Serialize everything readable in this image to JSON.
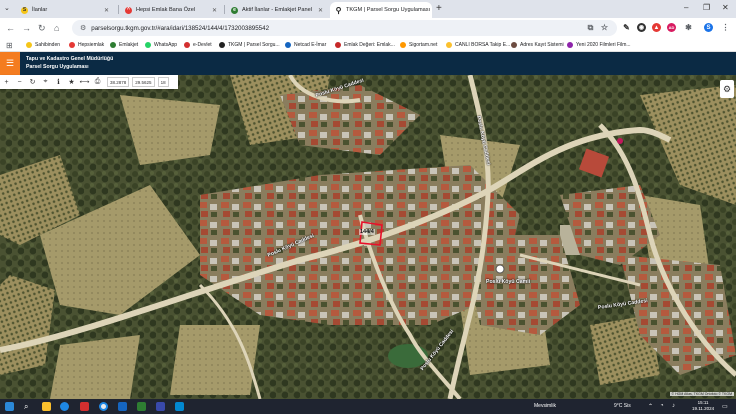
{
  "browser": {
    "tabs": [
      {
        "title": "İlanlar",
        "active": false,
        "color": "#f5c518",
        "letter": "S"
      },
      {
        "title": "Hepsi Emlak Bana Özel",
        "active": false,
        "color": "#e53935",
        "letter": "^"
      },
      {
        "title": "Aktif İlanlar - Emlakjet Panel",
        "active": false,
        "color": "#2e7d32",
        "letter": "e"
      },
      {
        "title": "TKGM | Parsel Sorgu Uygulaması",
        "active": true,
        "color": "#222222",
        "letter": "•"
      }
    ],
    "url": "parselsorgu.tkgm.gov.tr/#ara/idari/138524/144/4/1732003895542"
  },
  "bookmarks": [
    {
      "label": "Sahibinden",
      "color": "#f5c518"
    },
    {
      "label": "Hepsiemlak",
      "color": "#e53935"
    },
    {
      "label": "Emlakjet",
      "color": "#2e7d32"
    },
    {
      "label": "WhatsApp",
      "color": "#25d366"
    },
    {
      "label": "e-Devlet",
      "color": "#d32f2f"
    },
    {
      "label": "TKGM | Parsel Sorgu...",
      "color": "#222222"
    },
    {
      "label": "Netcad E-İmar",
      "color": "#1565c0"
    },
    {
      "label": "Emlak Değeri: Emlak...",
      "color": "#c62828"
    },
    {
      "label": "Sigortam.net",
      "color": "#ff9800"
    },
    {
      "label": "CANLI BORSA Takip E...",
      "color": "#fbc02d"
    },
    {
      "label": "Adres Kayıt Sistemi",
      "color": "#6d4c41"
    },
    {
      "label": "Yeni 2020 Filmleri Film...",
      "color": "#8e24aa"
    }
  ],
  "app": {
    "title_line1": "Tapu ve Kadastro Genel Müdürlüğü",
    "title_line2": "Parsel Sorgu Uygulaması",
    "coord_x": "38.2878",
    "coord_y": "29.5625",
    "zoom": "18"
  },
  "map": {
    "parcel_label": "144/4",
    "road_labels": [
      "Poslu Köyü Caddesi",
      "Poslu Köyü Caddesi",
      "Poslu Köyü Caddesi",
      "Poslu Köyü Caddesi",
      "Poslu Köyü Caddesi",
      "Poslu Köyü Camii"
    ],
    "attribution": "© HGM Atlas, TKGM Ortofoto © TKGM"
  },
  "taskbar": {
    "weather": "Mevsimlik",
    "temp": "9°C Sis",
    "time": "15:11",
    "date": "19.11.2024"
  }
}
